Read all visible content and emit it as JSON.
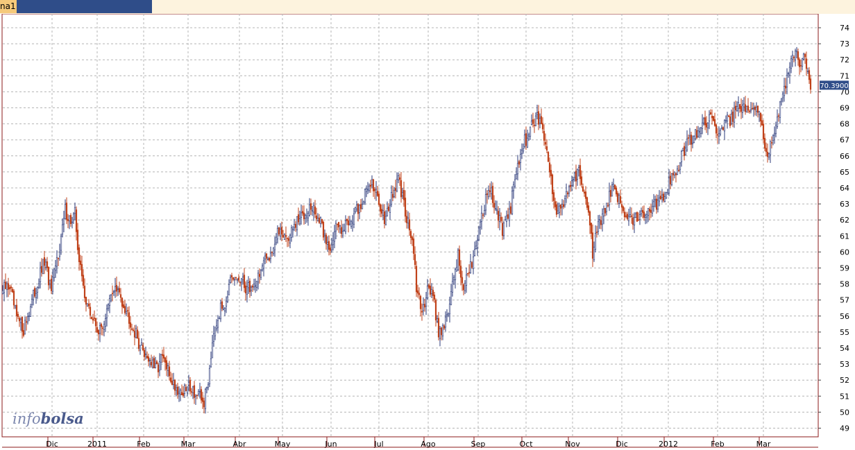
{
  "tab": {
    "label": "na1"
  },
  "colors": {
    "up": "#2b3a7a",
    "down": "#c0421a",
    "grid": "#b4b4b4",
    "frame": "#8b1a1a",
    "tab": "#2f4d89",
    "price_tag": "#2f4d89"
  },
  "watermark": {
    "part1": "info",
    "part2": "bolsa"
  },
  "chart_data": {
    "type": "candlestick",
    "y_ticks": [
      49,
      50,
      51,
      52,
      53,
      54,
      55,
      56,
      57,
      58,
      59,
      60,
      61,
      62,
      63,
      64,
      65,
      66,
      67,
      68,
      69,
      70,
      71,
      72,
      73,
      74
    ],
    "ylim": [
      48.3,
      74.4
    ],
    "x_labels": [
      "Dic",
      "2011",
      "Feb",
      "Mar",
      "Abr",
      "May",
      "Jun",
      "Jul",
      "Ago",
      "Sep",
      "Oct",
      "Nov",
      "Dic",
      "2012",
      "Feb",
      "Mar"
    ],
    "last_price": "70.3900",
    "grid": true,
    "anchors": [
      [
        0,
        57.6
      ],
      [
        5,
        57.9
      ],
      [
        10,
        55.8
      ],
      [
        15,
        55.2
      ],
      [
        20,
        56.6
      ],
      [
        25,
        58.0
      ],
      [
        30,
        59.4
      ],
      [
        35,
        57.5
      ],
      [
        38,
        59.0
      ],
      [
        42,
        60.9
      ],
      [
        45,
        62.6
      ],
      [
        50,
        61.8
      ],
      [
        52,
        62.4
      ],
      [
        55,
        59.5
      ],
      [
        58,
        57.8
      ],
      [
        62,
        56.3
      ],
      [
        66,
        55.6
      ],
      [
        70,
        55.0
      ],
      [
        75,
        56.2
      ],
      [
        80,
        57.8
      ],
      [
        85,
        57.2
      ],
      [
        90,
        56.2
      ],
      [
        95,
        55.0
      ],
      [
        100,
        54.0
      ],
      [
        105,
        53.4
      ],
      [
        110,
        52.6
      ],
      [
        115,
        53.4
      ],
      [
        120,
        52.3
      ],
      [
        125,
        51.5
      ],
      [
        130,
        51.2
      ],
      [
        135,
        51.7
      ],
      [
        140,
        51.0
      ],
      [
        145,
        50.6
      ],
      [
        148,
        52.0
      ],
      [
        152,
        55.3
      ],
      [
        156,
        56.2
      ],
      [
        160,
        56.9
      ],
      [
        164,
        58.0
      ],
      [
        170,
        58.3
      ],
      [
        175,
        57.8
      ],
      [
        180,
        57.8
      ],
      [
        185,
        58.7
      ],
      [
        190,
        59.5
      ],
      [
        195,
        60.4
      ],
      [
        200,
        61.5
      ],
      [
        205,
        60.8
      ],
      [
        210,
        61.5
      ],
      [
        215,
        62.2
      ],
      [
        220,
        62.8
      ],
      [
        225,
        62.5
      ],
      [
        230,
        61.5
      ],
      [
        235,
        60.2
      ],
      [
        240,
        61.5
      ],
      [
        245,
        61.6
      ],
      [
        250,
        62.0
      ],
      [
        255,
        62.5
      ],
      [
        260,
        63.3
      ],
      [
        265,
        64.5
      ],
      [
        270,
        63.3
      ],
      [
        275,
        62.2
      ],
      [
        280,
        63.3
      ],
      [
        285,
        64.5
      ],
      [
        290,
        62.6
      ],
      [
        295,
        60.7
      ],
      [
        298,
        57.8
      ],
      [
        302,
        56.0
      ],
      [
        306,
        58.0
      ],
      [
        310,
        57.3
      ],
      [
        314,
        55.0
      ],
      [
        318,
        55.5
      ],
      [
        322,
        56.6
      ],
      [
        325,
        58.5
      ],
      [
        328,
        59.8
      ],
      [
        332,
        57.7
      ],
      [
        336,
        58.6
      ],
      [
        340,
        60.3
      ],
      [
        345,
        62.3
      ],
      [
        350,
        64.0
      ],
      [
        355,
        63.0
      ],
      [
        360,
        61.2
      ],
      [
        365,
        62.3
      ],
      [
        370,
        65.0
      ],
      [
        375,
        66.7
      ],
      [
        380,
        67.6
      ],
      [
        385,
        68.5
      ],
      [
        390,
        67.3
      ],
      [
        395,
        64.5
      ],
      [
        400,
        62.2
      ],
      [
        405,
        63.5
      ],
      [
        410,
        64.4
      ],
      [
        415,
        65.0
      ],
      [
        420,
        63.5
      ],
      [
        425,
        60.0
      ],
      [
        430,
        61.8
      ],
      [
        435,
        63.0
      ],
      [
        440,
        64.0
      ],
      [
        445,
        63.0
      ],
      [
        450,
        62.2
      ],
      [
        455,
        62.1
      ],
      [
        460,
        62.5
      ],
      [
        465,
        62.6
      ],
      [
        470,
        63.0
      ],
      [
        475,
        63.5
      ],
      [
        480,
        64.3
      ],
      [
        485,
        65.0
      ],
      [
        490,
        66.1
      ],
      [
        495,
        67.0
      ],
      [
        500,
        67.4
      ],
      [
        505,
        68.1
      ],
      [
        510,
        68.2
      ],
      [
        515,
        67.7
      ],
      [
        520,
        68.0
      ],
      [
        525,
        68.4
      ],
      [
        530,
        68.9
      ],
      [
        535,
        69.2
      ],
      [
        540,
        69.2
      ],
      [
        545,
        68.8
      ],
      [
        548,
        67.2
      ],
      [
        551,
        66.2
      ],
      [
        555,
        67.3
      ],
      [
        559,
        68.6
      ],
      [
        563,
        70.3
      ],
      [
        567,
        71.4
      ],
      [
        571,
        72.3
      ],
      [
        575,
        71.8
      ],
      [
        578,
        72.4
      ],
      [
        580,
        71.2
      ],
      [
        582,
        70.4
      ]
    ]
  }
}
